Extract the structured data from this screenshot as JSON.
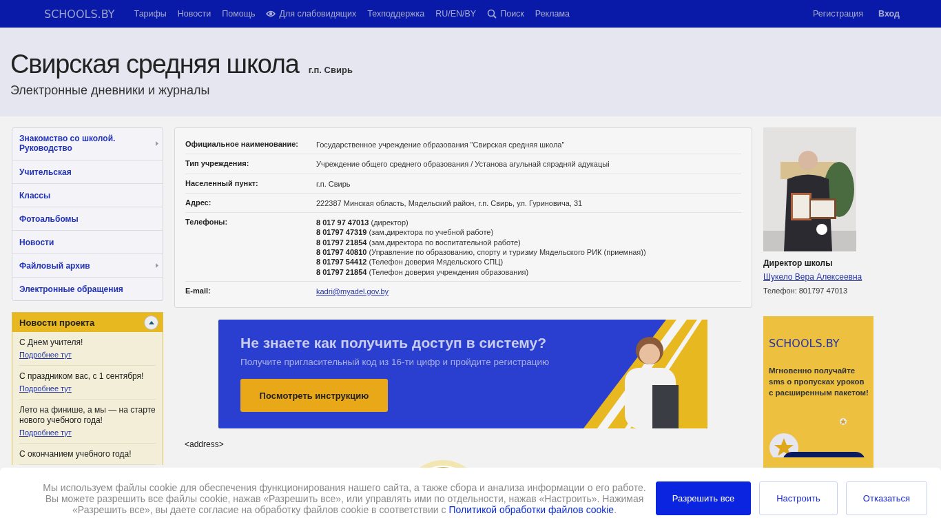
{
  "navbar": {
    "logo": "SCHOOLS.BY",
    "links": [
      {
        "label": "Тарифы",
        "kind": "plain"
      },
      {
        "label": "Новости",
        "kind": "plain"
      },
      {
        "label": "Помощь",
        "kind": "plain"
      },
      {
        "label": "Для слабовидящих",
        "kind": "accessibility"
      },
      {
        "label": "Техподдержка",
        "kind": "plain"
      },
      {
        "label": "RU/EN/BY",
        "kind": "plain"
      },
      {
        "label": "Поиск",
        "kind": "search"
      },
      {
        "label": "Реклама",
        "kind": "plain"
      }
    ],
    "account": [
      {
        "label": "Регистрация",
        "bold": false
      },
      {
        "label": "Вход",
        "bold": true
      }
    ]
  },
  "header": {
    "title": "Свирская средняя школа",
    "locality": "г.п. Свирь",
    "subtitle": "Электронные дневники и журналы"
  },
  "sidebar": {
    "items": [
      {
        "label": "Знакомство со школой. Руководство",
        "has_submenu": true
      },
      {
        "label": "Учительская",
        "has_submenu": false
      },
      {
        "label": "Классы",
        "has_submenu": false
      },
      {
        "label": "Фотоальбомы",
        "has_submenu": false
      },
      {
        "label": "Новости",
        "has_submenu": false
      },
      {
        "label": "Файловый архив",
        "has_submenu": true
      },
      {
        "label": "Электронные обращения",
        "has_submenu": false
      }
    ],
    "news": {
      "title": "Новости проекта",
      "expanded": true,
      "items": [
        {
          "text": "С Днем учителя!",
          "link": "Подробнее тут"
        },
        {
          "text": "С праздником вас, с 1 сентября!",
          "link": "Подробнее тут"
        },
        {
          "text": "Лето на финише, а мы — на старте нового учебного года!",
          "link": "Подробнее тут"
        },
        {
          "text": "С окончанием учебного года!"
        }
      ]
    }
  },
  "info": {
    "rows": [
      {
        "kind": "text",
        "label": "Официальное наименование:",
        "value": "Государственное учреждение образования \"Свирская средняя школа\""
      },
      {
        "kind": "text",
        "label": "Тип учреждения:",
        "value": "Учреждение общего среднего образования / Установа агульнай сярэдняй адукацыі"
      },
      {
        "kind": "text",
        "label": "Населенный пункт:",
        "value": "г.п. Свирь"
      },
      {
        "kind": "text",
        "label": "Адрес:",
        "value": "222387 Минская область, Мядельский район, г.п. Свирь, ул. Гуриновича, 31"
      },
      {
        "kind": "phones",
        "label": "Телефоны:",
        "lines": [
          {
            "number": "8 017 97 47013",
            "note": "(директор)"
          },
          {
            "number": "8 01797 47319",
            "note": "(зам.директора по учебной работе)"
          },
          {
            "number": "8 01797 21854",
            "note": "(зам.директора по воспитательной работе)"
          },
          {
            "number": "8 01797 40810",
            "note": "(Управление по образованию, спорту и туризму Мядельского РИК (приемная))"
          },
          {
            "number": "8 01797 54412",
            "note": "(Телефон доверия Мядельского СПЦ)"
          },
          {
            "number": "8 01797 21854",
            "note": "(Телефон доверия учреждения образования)"
          }
        ]
      },
      {
        "kind": "email",
        "label": "E-mail:",
        "value": "kadri@myadel.gov.by"
      }
    ]
  },
  "banner": {
    "heading": "Не знаете как получить доступ в систему?",
    "text": "Получите пригласительный код из 16-ти цифр и пройдите регистрацию",
    "button": "Посмотреть инструкцию"
  },
  "address_text": "<address>",
  "director": {
    "role": "Директор школы",
    "name": "Шукело Вера Алексеевна",
    "phone": "Телефон: 801797 47013"
  },
  "ad": {
    "logo": "SCHOOLS.BY",
    "text": "Мгновенно получайте sms о пропусках уроков с расширенным пакетом!"
  },
  "cookie_bar": {
    "text": "Мы используем файлы cookie для обеспечения функционирования нашего сайта, а также сбора и анализа информации о его работе. Вы можете разрешить все файлы cookie, нажав «Разрешить все», или управлять ими по отдельности, нажав «Настроить». Нажимая «Разрешить все», вы даете согласие на обработку файлов cookie в соответствии с ",
    "link": "Политикой обработки файлов cookie",
    "tail": ".",
    "buttons": [
      {
        "label": "Разрешить все",
        "kind": "primary"
      },
      {
        "label": "Настроить",
        "kind": "secondary"
      },
      {
        "label": "Отказаться",
        "kind": "secondary"
      }
    ]
  }
}
